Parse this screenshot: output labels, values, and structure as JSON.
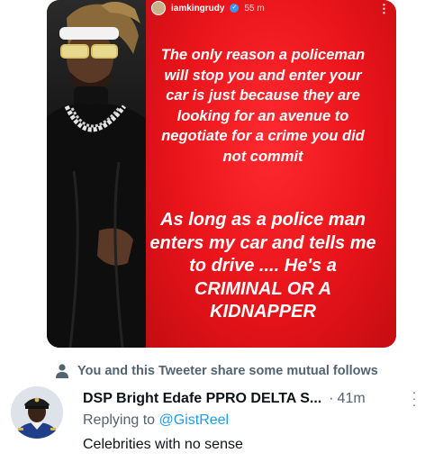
{
  "story": {
    "username": "iamkingrudy",
    "time": "55 m",
    "more_icon": "more-vertical-icon",
    "text_part1": "The only reason a policeman will stop you and enter your car is just because they are looking for an avenue to negotiate for a crime you did not commit",
    "text_part2": "As long as a police man enters my car and tells me to drive .... He's a CRIMINAL OR A KIDNAPPER"
  },
  "social_context": {
    "icon": "person-icon",
    "text": "You and this Tweeter share some mutual follows"
  },
  "tweet": {
    "display_name": "DSP Bright Edafe PPRO DELTA S...",
    "separator": "·",
    "timestamp": "41m",
    "replying_prefix": "Replying to ",
    "replying_handle": "@GistReel",
    "text": "Celebrities with no sense"
  },
  "colors": {
    "story_red": "#e8161b",
    "link_blue": "#1d9bf0",
    "muted_gray": "#536471",
    "text_dark": "#0f1419"
  }
}
